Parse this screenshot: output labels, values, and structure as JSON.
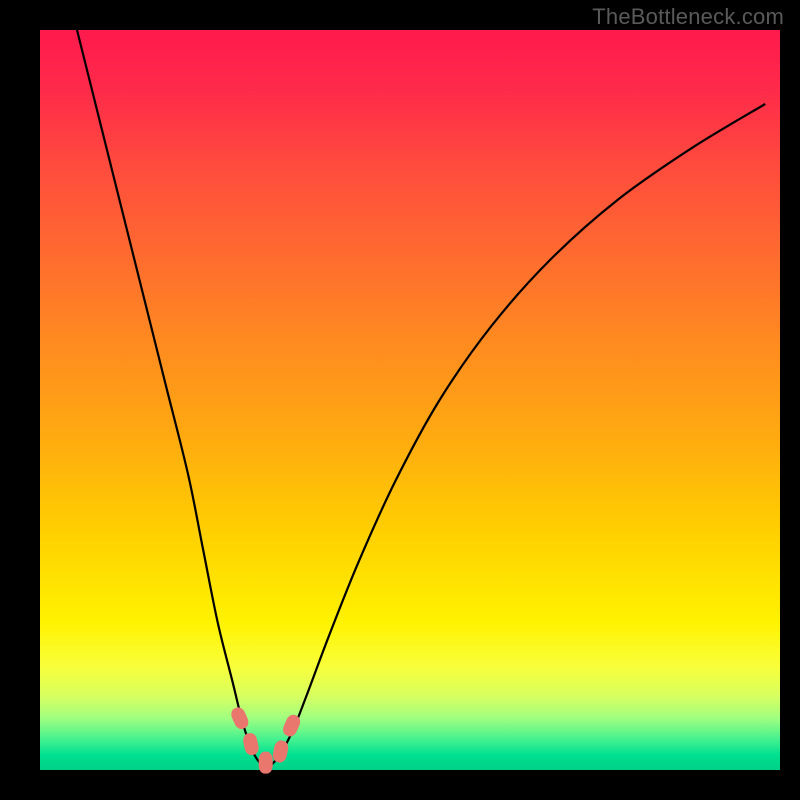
{
  "watermark": "TheBottleneck.com",
  "colors": {
    "curve": "#000000",
    "marker": "#e9776e",
    "gradient_top": "#ff1a4d",
    "gradient_bottom": "#00d088"
  },
  "chart_data": {
    "type": "line",
    "title": "",
    "xlabel": "",
    "ylabel": "",
    "xlim": [
      0,
      100
    ],
    "ylim": [
      0,
      100
    ],
    "x": [
      5,
      8,
      11,
      14,
      17,
      20,
      22,
      24,
      26,
      27.5,
      29,
      30.5,
      32,
      34,
      36,
      39,
      43,
      48,
      54,
      61,
      69,
      78,
      88,
      98
    ],
    "values": [
      100,
      88,
      76,
      64,
      52,
      40,
      30,
      20,
      12,
      6,
      2,
      0.5,
      1.5,
      5,
      10,
      18,
      28,
      39,
      50,
      60,
      69,
      77,
      84,
      90
    ],
    "minimum_x": 30.5,
    "marker_points": [
      {
        "x": 27.0,
        "y": 7.0
      },
      {
        "x": 28.5,
        "y": 3.5
      },
      {
        "x": 30.5,
        "y": 1.0
      },
      {
        "x": 32.5,
        "y": 2.5
      },
      {
        "x": 34.0,
        "y": 6.0
      }
    ]
  }
}
